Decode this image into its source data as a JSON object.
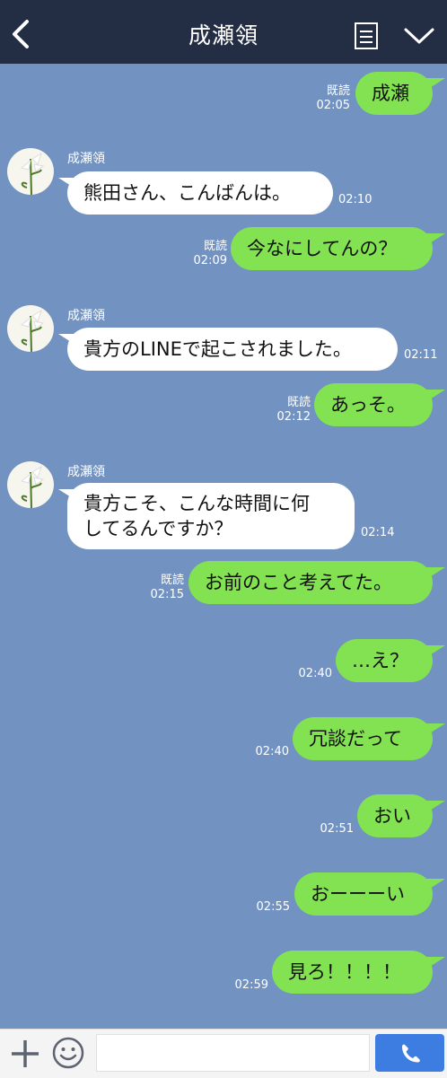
{
  "header": {
    "title": "成瀬領"
  },
  "messages": [
    {
      "dir": "out",
      "text": "成瀬",
      "read": "既読",
      "time": "02:05"
    },
    {
      "dir": "in",
      "sender": "成瀬領",
      "text": "熊田さん、こんばんは。",
      "time": "02:10"
    },
    {
      "dir": "out",
      "text": "今なにしてんの？",
      "read": "既読",
      "time": "02:09"
    },
    {
      "dir": "in",
      "sender": "成瀬領",
      "text": "貴方のLINEで起こされました。",
      "time": "02:11"
    },
    {
      "dir": "out",
      "text": "あっそ。",
      "read": "既読",
      "time": "02:12"
    },
    {
      "dir": "in",
      "sender": "成瀬領",
      "text_lines": [
        "貴方こそ、こんな時間に何",
        "してるんですか？"
      ],
      "time": "02:14"
    },
    {
      "dir": "out",
      "text": "お前のこと考えてた。",
      "read": "既読",
      "time": "02:15"
    },
    {
      "dir": "out",
      "text": "…え？",
      "time": "02:40"
    },
    {
      "dir": "out",
      "text": "冗談だって",
      "time": "02:40"
    },
    {
      "dir": "out",
      "text": "おい",
      "time": "02:51"
    },
    {
      "dir": "out",
      "text": "おーーーい",
      "time": "02:55"
    },
    {
      "dir": "out",
      "text": "見ろ！！！！",
      "time": "02:59"
    }
  ],
  "input": {
    "value": ""
  },
  "colors": {
    "background": "#7293c2",
    "header": "#232d43",
    "outgoing": "#83e252",
    "incoming": "#ffffff",
    "send": "#3d7de2"
  },
  "icons": {
    "back": "chevron-left-icon",
    "notes": "notes-icon",
    "menu": "chevron-down-icon",
    "plus": "plus-icon",
    "emoji": "emoji-icon",
    "call": "phone-icon"
  }
}
